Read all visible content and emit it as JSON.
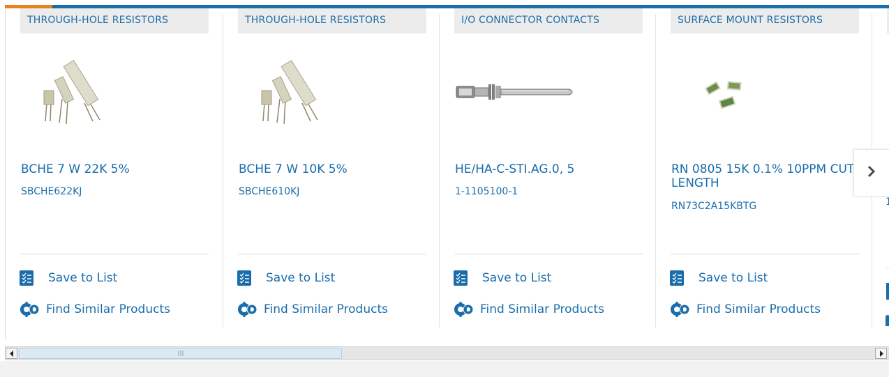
{
  "products": [
    {
      "category": "THROUGH-HOLE RESISTORS",
      "title": "BCHE 7 W 22K 5%",
      "part_number": "SBCHE622KJ",
      "image": "through-hole-resistors-photo",
      "save_label": "Save to List",
      "similar_label": "Find Similar Products"
    },
    {
      "category": "THROUGH-HOLE RESISTORS",
      "title": "BCHE 7 W 10K 5%",
      "part_number": "SBCHE610KJ",
      "image": "through-hole-resistors-photo",
      "save_label": "Save to List",
      "similar_label": "Find Similar Products"
    },
    {
      "category": "I/O CONNECTOR CONTACTS",
      "title": "HE/HA-C-STI.AG.0, 5",
      "part_number": "1-1105100-1",
      "image": "connector-contact-pin-photo",
      "save_label": "Save to List",
      "similar_label": "Find Similar Products"
    },
    {
      "category": "SURFACE MOUNT RESISTORS",
      "title": "RN 0805 15K 0.1% 10PPM CUT LENGTH",
      "part_number": "RN73C2A15KBTG",
      "image": "smd-resistors-photo",
      "save_label": "Save to List",
      "similar_label": "Find Similar Products"
    }
  ],
  "partial_card": {
    "part_number_fragment": "1"
  },
  "icons": {
    "save": "list-checkmark-icon",
    "similar": "gears-icon",
    "next": "chevron-right-icon"
  },
  "colors": {
    "link": "#1a6dab",
    "accent": "#e8811f",
    "category_bg": "#ececec"
  }
}
